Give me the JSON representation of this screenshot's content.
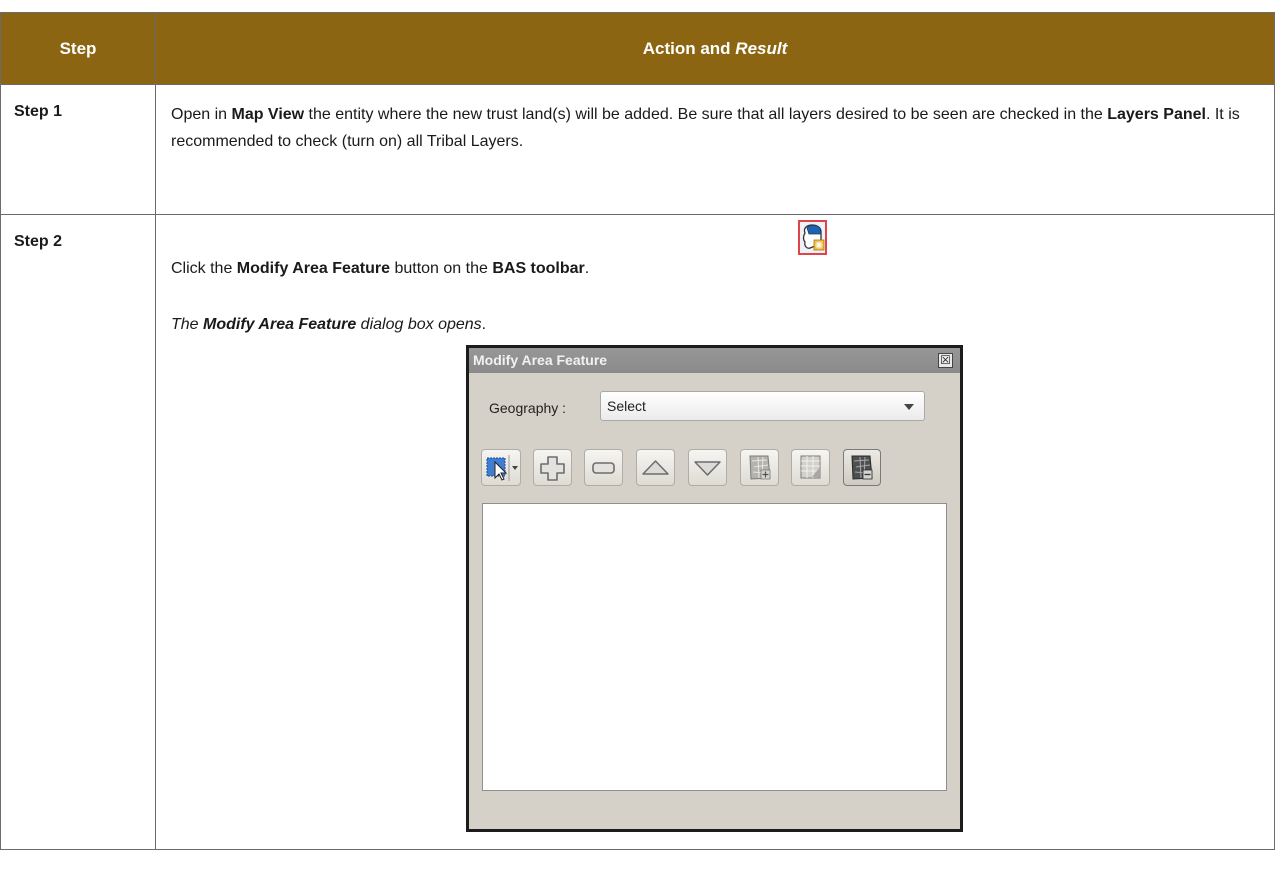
{
  "table": {
    "header": {
      "step": "Step",
      "action_part1": "Action and ",
      "action_part2": "Result"
    },
    "rows": [
      {
        "step": "Step 1",
        "text": [
          {
            "t": "Open in ",
            "b": false
          },
          {
            "t": "Map View",
            "b": true
          },
          {
            "t": " the entity where the new trust land(s) will be added. Be sure that all layers desired to be seen are checked in the ",
            "b": false
          },
          {
            "t": "Layers Panel",
            "b": true
          },
          {
            "t": ". It is recommended to check (turn on) all Tribal Layers.",
            "b": false
          }
        ]
      },
      {
        "step": "Step 2",
        "line1": [
          {
            "t": "Click the ",
            "b": false
          },
          {
            "t": "Modify Area Feature",
            "b": true
          },
          {
            "t": " button on the ",
            "b": false
          },
          {
            "t": "BAS toolbar",
            "b": true
          },
          {
            "t": ".",
            "b": false
          }
        ],
        "line2": [
          {
            "t": "The ",
            "b": false
          },
          {
            "t": "Modify Area Feature",
            "b": true
          },
          {
            "t": " dialog box opens",
            "b": false
          },
          {
            "t": ".",
            "b": false
          }
        ]
      }
    ]
  },
  "toolbar_icon": "modify-area-feature-icon",
  "dialog": {
    "title": "Modify Area Feature",
    "close_label": "☒",
    "geography_label": "Geography :",
    "geography_value": "Select",
    "tools": [
      {
        "name": "select-tool-icon"
      },
      {
        "name": "add-icon"
      },
      {
        "name": "remove-icon"
      },
      {
        "name": "move-up-icon"
      },
      {
        "name": "move-down-icon"
      },
      {
        "name": "map-add-icon"
      },
      {
        "name": "map-table-icon"
      },
      {
        "name": "map-remove-icon"
      }
    ]
  },
  "colors": {
    "header_bg": "#8c6512",
    "header_text": "#ffffff",
    "highlight_border": "#e0434a"
  }
}
